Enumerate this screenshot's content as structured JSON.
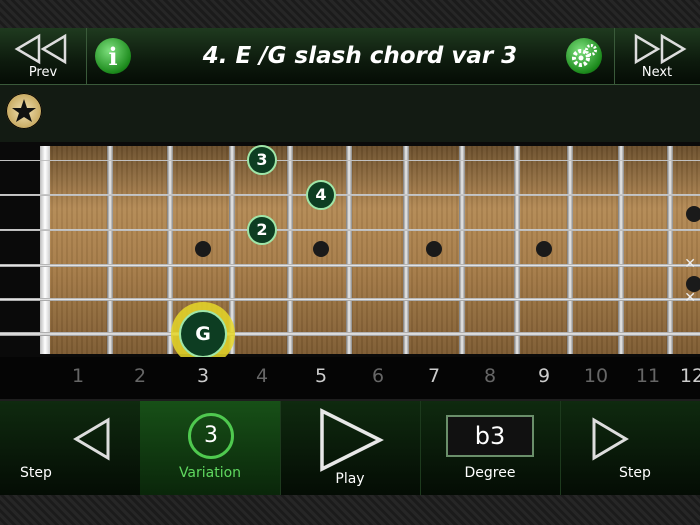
{
  "header": {
    "prev_label": "Prev",
    "next_label": "Next",
    "title": "4. E /G slash chord var 3"
  },
  "fretboard": {
    "fret_numbers": [
      "1",
      "2",
      "3",
      "4",
      "5",
      "6",
      "7",
      "8",
      "9",
      "10",
      "11",
      "12"
    ],
    "highlighted_frets": [
      "3",
      "5",
      "7",
      "9",
      "12"
    ],
    "fingers": [
      {
        "label": "3",
        "string": 1,
        "fret": 4
      },
      {
        "label": "4",
        "string": 2,
        "fret": 5
      },
      {
        "label": "2",
        "string": 3,
        "fret": 4
      }
    ],
    "root": {
      "label": "G",
      "string": 6,
      "fret": 3
    },
    "muted_strings": [
      4,
      5
    ],
    "mute_symbol": "✕"
  },
  "controls": {
    "step_back_label": "Step",
    "variation_label": "Variation",
    "variation_value": "3",
    "play_label": "Play",
    "degree_label": "Degree",
    "degree_value": "b3",
    "step_forward_label": "Step"
  },
  "colors": {
    "accent_green": "#4fc94f",
    "root_glow": "#e6d728",
    "header_bg": "#0d1a0d"
  }
}
